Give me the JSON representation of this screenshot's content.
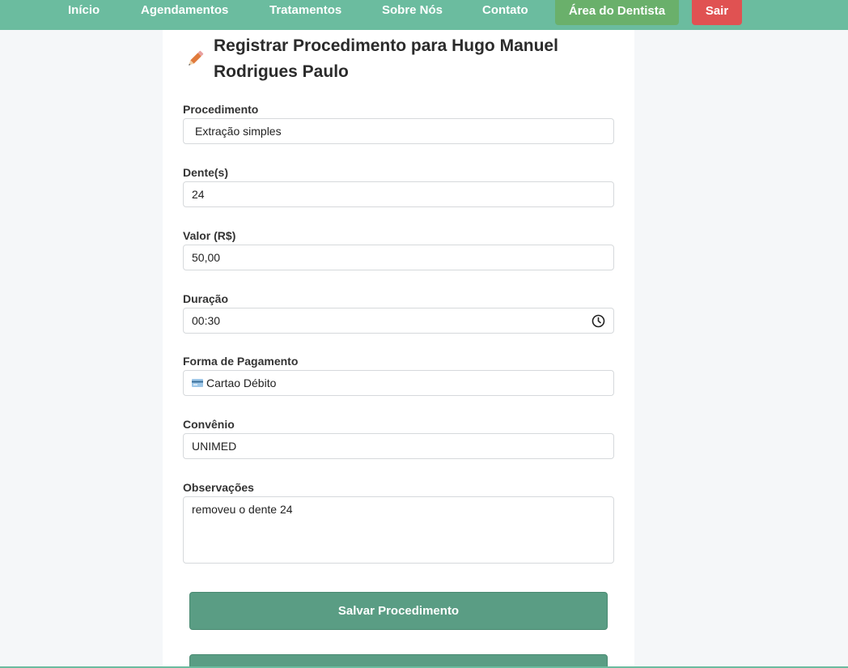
{
  "nav": {
    "items": [
      {
        "label": "Início"
      },
      {
        "label": "Agendamentos"
      },
      {
        "label": "Tratamentos"
      },
      {
        "label": "Sobre Nós"
      },
      {
        "label": "Contato"
      }
    ],
    "dentist_area": "Área do Dentista",
    "logout": "Sair",
    "colors": {
      "bar": "#6bbc9f",
      "dentist": "#6ab06b",
      "logout": "#e05252"
    }
  },
  "form": {
    "title_line1": "Registrar Procedimento para Hugo Manuel",
    "title_line2": "Rodrigues Paulo",
    "title_icon": "pencil-icon",
    "procedure": {
      "label": "Procedimento",
      "value": "Extração simples"
    },
    "teeth": {
      "label": "Dente(s)",
      "value": "24"
    },
    "price": {
      "label": "Valor (R$)",
      "value": "50,00"
    },
    "duration": {
      "label": "Duração",
      "value": "00:30",
      "icon": "clock-icon"
    },
    "payment": {
      "label": "Forma de Pagamento",
      "value": "Cartao Débito",
      "icon": "credit-card-icon"
    },
    "insurance": {
      "label": "Convênio",
      "value": "UNIMED"
    },
    "notes": {
      "label": "Observações",
      "value": "removeu o dente 24"
    },
    "save_button": "Salvar Procedimento",
    "button_color": "#5a9d84"
  }
}
